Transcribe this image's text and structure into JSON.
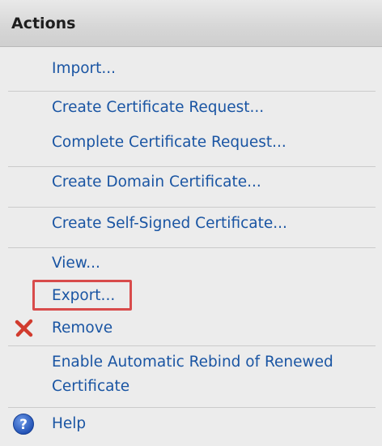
{
  "header": {
    "title": "Actions"
  },
  "actions": {
    "import": "Import...",
    "create_cert_request": "Create Certificate Request...",
    "complete_cert_request": "Complete Certificate Request...",
    "create_domain_cert": "Create Domain Certificate...",
    "create_self_signed_cert": "Create Self-Signed Certificate...",
    "view": "View...",
    "export": "Export...",
    "remove": "Remove",
    "enable_rebind": "Enable Automatic Rebind of Renewed Certificate",
    "help": "Help"
  },
  "icons": {
    "remove": "red-x-icon",
    "help": "help-question-icon"
  },
  "colors": {
    "link": "#1a55a3",
    "highlight": "#d84b4b",
    "remove_icon": "#d13b2e",
    "help_icon": "#2b5fc7"
  }
}
